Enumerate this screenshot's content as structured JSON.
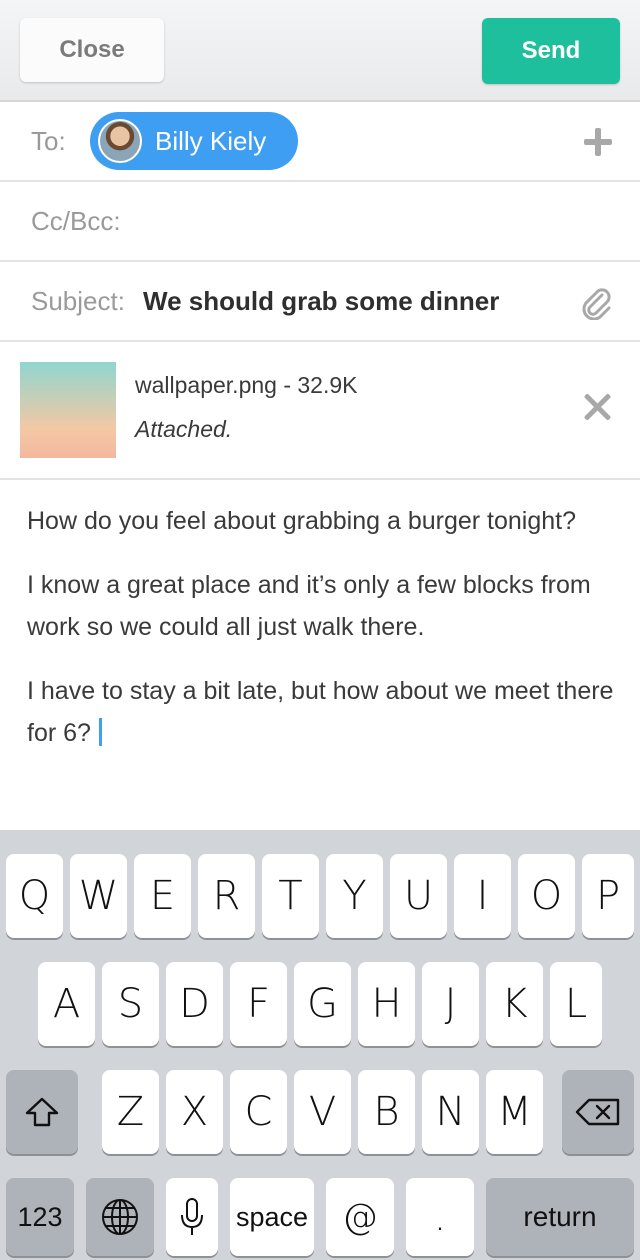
{
  "toolbar": {
    "close_label": "Close",
    "send_label": "Send"
  },
  "header": {
    "to_label": "To:",
    "recipient": {
      "name": "Billy Kiely"
    },
    "cc_label": "Cc/Bcc:",
    "subject_label": "Subject:",
    "subject_value": "We should grab some dinner"
  },
  "attachment": {
    "filename": "wallpaper.png - 32.9K",
    "status": "Attached."
  },
  "message": {
    "paragraphs": [
      "How do you feel about grabbing a burger tonight?",
      "I know a great place and it’s only a few blocks from work so we could all just walk there.",
      "I have to stay a bit late, but how about we meet there for 6?"
    ]
  },
  "keyboard": {
    "row1": [
      "Q",
      "W",
      "E",
      "R",
      "T",
      "Y",
      "U",
      "I",
      "O",
      "P"
    ],
    "row2": [
      "A",
      "S",
      "D",
      "F",
      "G",
      "H",
      "J",
      "K",
      "L"
    ],
    "row3": [
      "Z",
      "X",
      "C",
      "V",
      "B",
      "N",
      "M"
    ],
    "bottom": {
      "numbers": "123",
      "space": "space",
      "at": "@",
      "period": ".",
      "return": "return"
    }
  },
  "icons": [
    "plus-icon",
    "paperclip-icon",
    "remove-icon",
    "shift-icon",
    "backspace-icon",
    "globe-icon",
    "microphone-icon"
  ],
  "colors": {
    "accent": "#3e9ef2",
    "send": "#1ebf9d",
    "keyboard_bg": "#d1d4d8"
  }
}
